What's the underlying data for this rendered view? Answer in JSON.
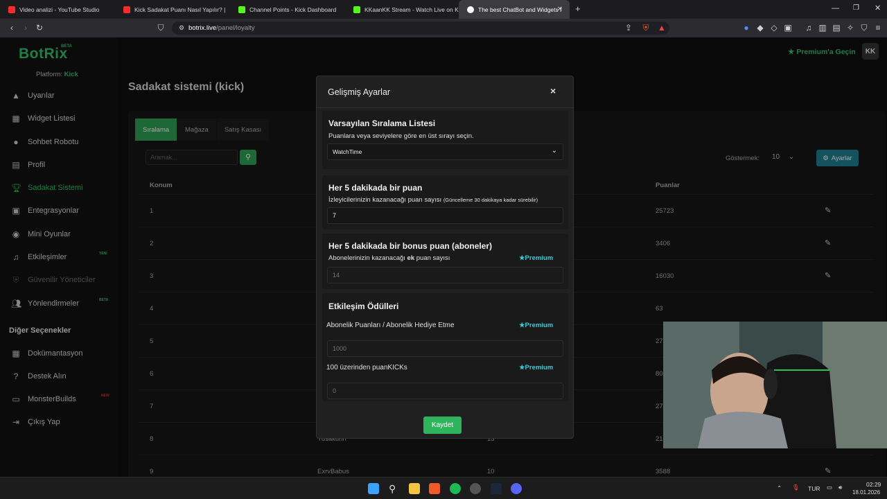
{
  "browser": {
    "tabs": [
      {
        "label": "Video analizi - YouTube Studio",
        "color": "#ff2a2a"
      },
      {
        "label": "Kick Sadakat Puanı Nasıl Yapılır? |",
        "color": "#ff2a2a"
      },
      {
        "label": "Channel Points - Kick Dashboard",
        "color": "#53fc18"
      },
      {
        "label": "KKaanKK Stream - Watch Live on Kick",
        "color": "#53fc18"
      },
      {
        "label": "The best ChatBot and Widgets f",
        "color": "#ffffff"
      }
    ],
    "new_tab": "+",
    "url_host": "botrix.live",
    "url_path": "/panel/loyalty"
  },
  "sidebar": {
    "logo": "BotRix",
    "beta": "BETA",
    "platform_label": "Platform:",
    "platform_value": "Kick",
    "items": [
      {
        "label": "Uyarılar",
        "icon": "warning-icon"
      },
      {
        "label": "Widget Listesi",
        "icon": "list-icon"
      },
      {
        "label": "Sohbet Robotu",
        "icon": "robot-icon"
      },
      {
        "label": "Profil",
        "icon": "profile-icon"
      },
      {
        "label": "Sadakat Sistemi",
        "icon": "trophy-icon"
      },
      {
        "label": "Entegrasyonlar",
        "icon": "integration-icon"
      },
      {
        "label": "Mini Oyunlar",
        "icon": "gamepad-icon"
      },
      {
        "label": "Etkileşimler",
        "icon": "music-icon"
      },
      {
        "label": "Güvenilir Yöneticiler",
        "icon": "shield-icon"
      },
      {
        "label": "Yönlendirmeler",
        "icon": "users-icon"
      }
    ],
    "badge_new": "YENİ",
    "badge_beta": "BETA",
    "other_heading": "Diğer Seçenekler",
    "other_items": [
      {
        "label": "Dokümantasyon",
        "icon": "book-icon"
      },
      {
        "label": "Destek Alın",
        "icon": "help-icon"
      },
      {
        "label": "MonsterBuilds",
        "icon": "monitor-icon"
      },
      {
        "label": "Çıkış Yap",
        "icon": "logout-icon"
      }
    ],
    "monster_badge": "NEW"
  },
  "main": {
    "title": "Sadakat sistemi (kick)",
    "premium_link": "Premium'a Geçin",
    "avatar": "KK",
    "tabs": [
      "Sıralama",
      "Mağaza",
      "Satış Kasası"
    ],
    "search_placeholder": "Aramak...",
    "show_label": "Göstermek:",
    "show_value": "10",
    "settings_button": "Ayarlar",
    "columns": {
      "position": "Konum",
      "points": "Puanlar"
    },
    "rows": [
      {
        "pos": "1",
        "name": "",
        "value": "",
        "points": "25723"
      },
      {
        "pos": "2",
        "name": "",
        "value": "",
        "points": "3406"
      },
      {
        "pos": "3",
        "name": "",
        "value": "",
        "points": "16030"
      },
      {
        "pos": "4",
        "name": "",
        "value": "",
        "points": "63"
      },
      {
        "pos": "5",
        "name": "",
        "value": "",
        "points": "27"
      },
      {
        "pos": "6",
        "name": "",
        "value": "",
        "points": "80"
      },
      {
        "pos": "7",
        "name": "",
        "value": "",
        "points": "27"
      },
      {
        "pos": "8",
        "name": "Yusakunn",
        "value": "13",
        "points": "2142"
      },
      {
        "pos": "9",
        "name": "ExrvBabus",
        "value": "10",
        "points": "3588"
      }
    ]
  },
  "modal": {
    "title": "Gelişmiş Ayarlar",
    "close": "×",
    "s1": {
      "heading": "Varsayılan Sıralama Listesi",
      "desc": "Puanlara veya seviyelere göre en üst sırayı seçin.",
      "select_value": "WatchTime"
    },
    "s2": {
      "heading": "Her 5 dakikada bir puan",
      "desc": "İzleyicilerinizin kazanacağı puan sayısı",
      "note": "(Güncelleme 30 dakikaya kadar sürebilir)",
      "value": "7"
    },
    "s3": {
      "heading": "Her 5 dakikada bir bonus puan (aboneler)",
      "desc_a": "Abonelerinizin kazanacağı",
      "desc_b": "ek",
      "desc_c": "puan sayısı",
      "value": "14"
    },
    "s4": {
      "heading": "Etkileşim Ödülleri",
      "f1_label": "Abonelik Puanları / Abonelik Hediye Etme",
      "f1_value": "1000",
      "f2_label": "100 üzerinden puanKICKs",
      "f2_value": "0"
    },
    "premium": "Premium",
    "save": "Kaydet"
  },
  "taskbar": {
    "lang": "TUR",
    "time": "02:29",
    "date": "18.01.2026"
  }
}
